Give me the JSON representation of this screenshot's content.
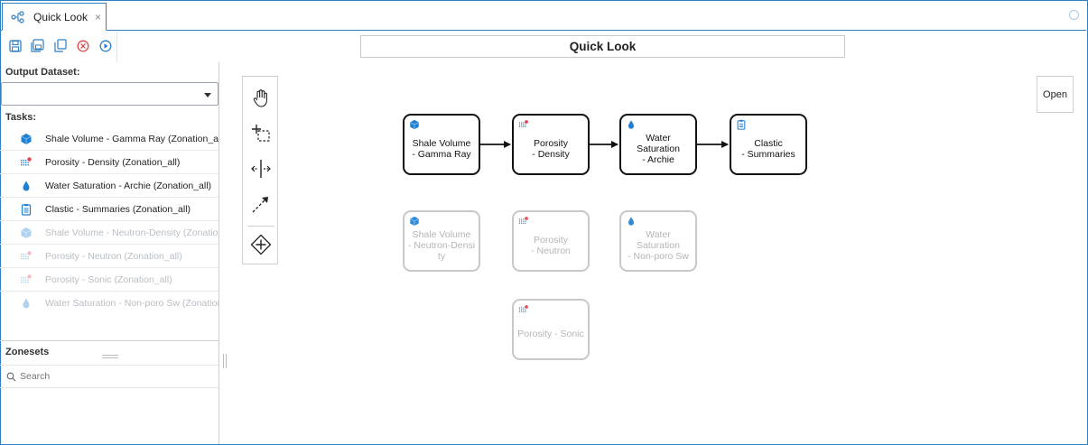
{
  "tab": {
    "label": "Quick Look",
    "close": "×"
  },
  "toolbar": {
    "icons": [
      "save-icon",
      "save-all-icon",
      "copy-icon",
      "cancel-icon",
      "run-icon"
    ]
  },
  "left_panel": {
    "output_dataset_label": "Output Dataset:",
    "output_dataset_value": "",
    "tasks_label": "Tasks:",
    "tasks": [
      {
        "label": "Shale Volume - Gamma Ray (Zonation_all)",
        "icon": "cube-icon",
        "enabled": true
      },
      {
        "label": "Porosity - Density (Zonation_all)",
        "icon": "porosity-icon",
        "enabled": true
      },
      {
        "label": "Water Saturation - Archie (Zonation_all)",
        "icon": "drop-icon",
        "enabled": true
      },
      {
        "label": "Clastic - Summaries (Zonation_all)",
        "icon": "clipboard-icon",
        "enabled": true
      },
      {
        "label": "Shale Volume - Neutron-Density (Zonation_all)",
        "icon": "cube-icon",
        "enabled": false
      },
      {
        "label": "Porosity - Neutron (Zonation_all)",
        "icon": "porosity-icon",
        "enabled": false
      },
      {
        "label": "Porosity - Sonic (Zonation_all)",
        "icon": "porosity-icon",
        "enabled": false
      },
      {
        "label": "Water Saturation - Non-poro Sw (Zonation_all)",
        "icon": "drop-icon",
        "enabled": false
      }
    ],
    "zonesets_label": "Zonesets",
    "search_placeholder": "Search"
  },
  "canvas": {
    "title": "Quick Look",
    "open_label": "Open",
    "palette_icons": [
      "hand-tool-icon",
      "lasso-select-icon",
      "space-tool-icon",
      "connect-tool-icon",
      "add-gateway-icon"
    ],
    "nodes": [
      {
        "label": "Shale Volume\n- Gamma Ray",
        "icon": "cube-icon",
        "enabled": true
      },
      {
        "label": "Porosity\n- Density",
        "icon": "porosity-icon",
        "enabled": true
      },
      {
        "label": "Water\nSaturation\n- Archie",
        "icon": "drop-icon",
        "enabled": true
      },
      {
        "label": "Clastic\n- Summaries",
        "icon": "clipboard-icon",
        "enabled": true
      },
      {
        "label": "Shale Volume\n- Neutron-Densi\nty",
        "icon": "cube-icon",
        "enabled": false
      },
      {
        "label": "Porosity\n- Neutron",
        "icon": "porosity-icon",
        "enabled": false
      },
      {
        "label": "Water\nSaturation\n- Non-poro Sw",
        "icon": "drop-icon",
        "enabled": false
      },
      {
        "label": "Porosity - Sonic",
        "icon": "porosity-icon",
        "enabled": false
      }
    ],
    "connections": [
      [
        0,
        1
      ],
      [
        1,
        2
      ],
      [
        2,
        3
      ]
    ]
  },
  "colors": {
    "accent": "#2f7fc1",
    "cube": "#1f7fd1",
    "cancel": "#e04848",
    "porosity_dot": "#e8414a"
  }
}
